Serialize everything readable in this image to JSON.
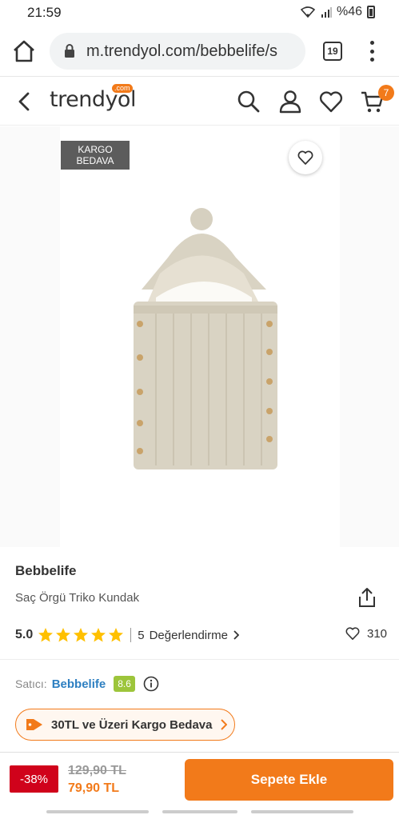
{
  "status": {
    "time": "21:59",
    "battery": "%46"
  },
  "browser": {
    "url": "m.trendyol.com/bebbelife/s",
    "tab_count": "19"
  },
  "header": {
    "logo": "trendyol",
    "logo_badge": ".com",
    "cart_count": "7"
  },
  "product": {
    "badge_line1": "KARGO",
    "badge_line2": "BEDAVA",
    "brand": "Bebbelife",
    "name": "Saç Örgü Triko Kundak",
    "rating": "5.0",
    "stars": 5,
    "review_count": "5",
    "review_label": "Değerlendirme",
    "favorite_count": "310"
  },
  "seller": {
    "label": "Satıcı:",
    "name": "Bebbelife",
    "score": "8.6"
  },
  "promo": {
    "text": "30TL ve Üzeri Kargo Bedava"
  },
  "pricing": {
    "discount": "-38%",
    "old_price": "129,90 TL",
    "new_price": "79,90 TL",
    "add_to_cart": "Sepete Ekle"
  },
  "colors": {
    "accent": "#f27a1a",
    "discount": "#d0021b",
    "seller_score": "#9dc53b",
    "star": "#ffc000"
  },
  "icons": [
    "home-icon",
    "lock-icon",
    "more-icon",
    "back-icon",
    "search-icon",
    "user-icon",
    "heart-icon",
    "cart-icon",
    "share-icon",
    "star-icon",
    "info-icon",
    "tag-icon",
    "chevron-right-icon"
  ]
}
